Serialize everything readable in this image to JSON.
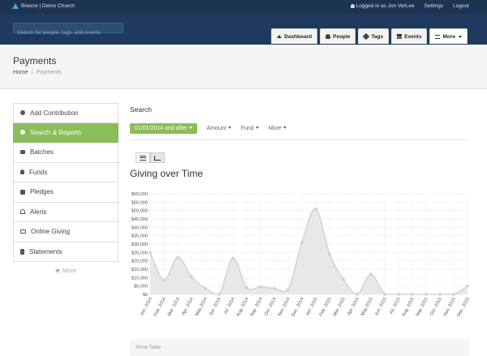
{
  "topbar": {
    "brand": "Breeze | Demo Church",
    "logged_in": "Logged in as Jon VerLee",
    "settings": "Settings",
    "logout": "Logout"
  },
  "header": {
    "search_placeholder": "Search for people, tags, and events",
    "tabs": [
      {
        "label": "Dashboard",
        "icon": "house-icon"
      },
      {
        "label": "People",
        "icon": "person-icon"
      },
      {
        "label": "Tags",
        "icon": "tag-icon"
      },
      {
        "label": "Events",
        "icon": "calendar-icon"
      },
      {
        "label": "More",
        "icon": "menu-icon"
      }
    ]
  },
  "page": {
    "title": "Payments",
    "breadcrumb_home": "Home",
    "breadcrumb_sep": "/",
    "breadcrumb_current": "Payments"
  },
  "sidebar": {
    "items": [
      {
        "label": "Add Contribution",
        "icon": "plus-circle-icon"
      },
      {
        "label": "Search & Reports",
        "icon": "search-icon"
      },
      {
        "label": "Batches",
        "icon": "stack-icon"
      },
      {
        "label": "Funds",
        "icon": "person-icon"
      },
      {
        "label": "Pledges",
        "icon": "gift-icon"
      },
      {
        "label": "Alerts",
        "icon": "bell-icon"
      },
      {
        "label": "Online Giving",
        "icon": "laptop-icon"
      },
      {
        "label": "Statements",
        "icon": "document-icon"
      }
    ],
    "active_index": 1,
    "more": "More"
  },
  "main": {
    "search_heading": "Search",
    "filters": {
      "date": "01/01/2014 and after",
      "amount": "Amount",
      "fund": "Fund",
      "more": "More"
    },
    "chart_heading": "Giving over Time",
    "show_table": "Show Table"
  },
  "colors": {
    "accent_green": "#8bbd5a",
    "navy": "#1f3a5c",
    "chart_fill": "#e8e8e8",
    "chart_line": "#d4d4d4"
  },
  "chart_data": {
    "type": "area",
    "title": "",
    "xlabel": "",
    "ylabel": "",
    "ylim": [
      0,
      60000
    ],
    "y_ticks": [
      "$0",
      "$5,000",
      "$10,000",
      "$15,000",
      "$20,000",
      "$25,000",
      "$30,000",
      "$35,000",
      "$40,000",
      "$45,000",
      "$50,000",
      "$55,000",
      "$60,000"
    ],
    "grid": true,
    "categories": [
      "Jan. 2014",
      "Feb. 2014",
      "Mar. 2014",
      "Apr. 2014",
      "May 2014",
      "Jun. 2014",
      "Jul. 2014",
      "Aug. 2014",
      "Sep. 2014",
      "Oct. 2014",
      "Nov. 2014",
      "Dec. 2014",
      "Jan. 2015",
      "Feb. 2015",
      "Mar. 2015",
      "Apr. 2015",
      "May 2015",
      "Jun. 2015",
      "Jul. 2015",
      "Aug. 2015",
      "Sep. 2015",
      "Oct. 2015",
      "Nov. 2015",
      "Dec. 2015"
    ],
    "values": [
      25000,
      8500,
      22000,
      10500,
      3500,
      0,
      21500,
      4000,
      4500,
      3500,
      3000,
      31000,
      51000,
      24000,
      9000,
      0,
      12000,
      0,
      0,
      0,
      0,
      0,
      0,
      5000
    ]
  }
}
